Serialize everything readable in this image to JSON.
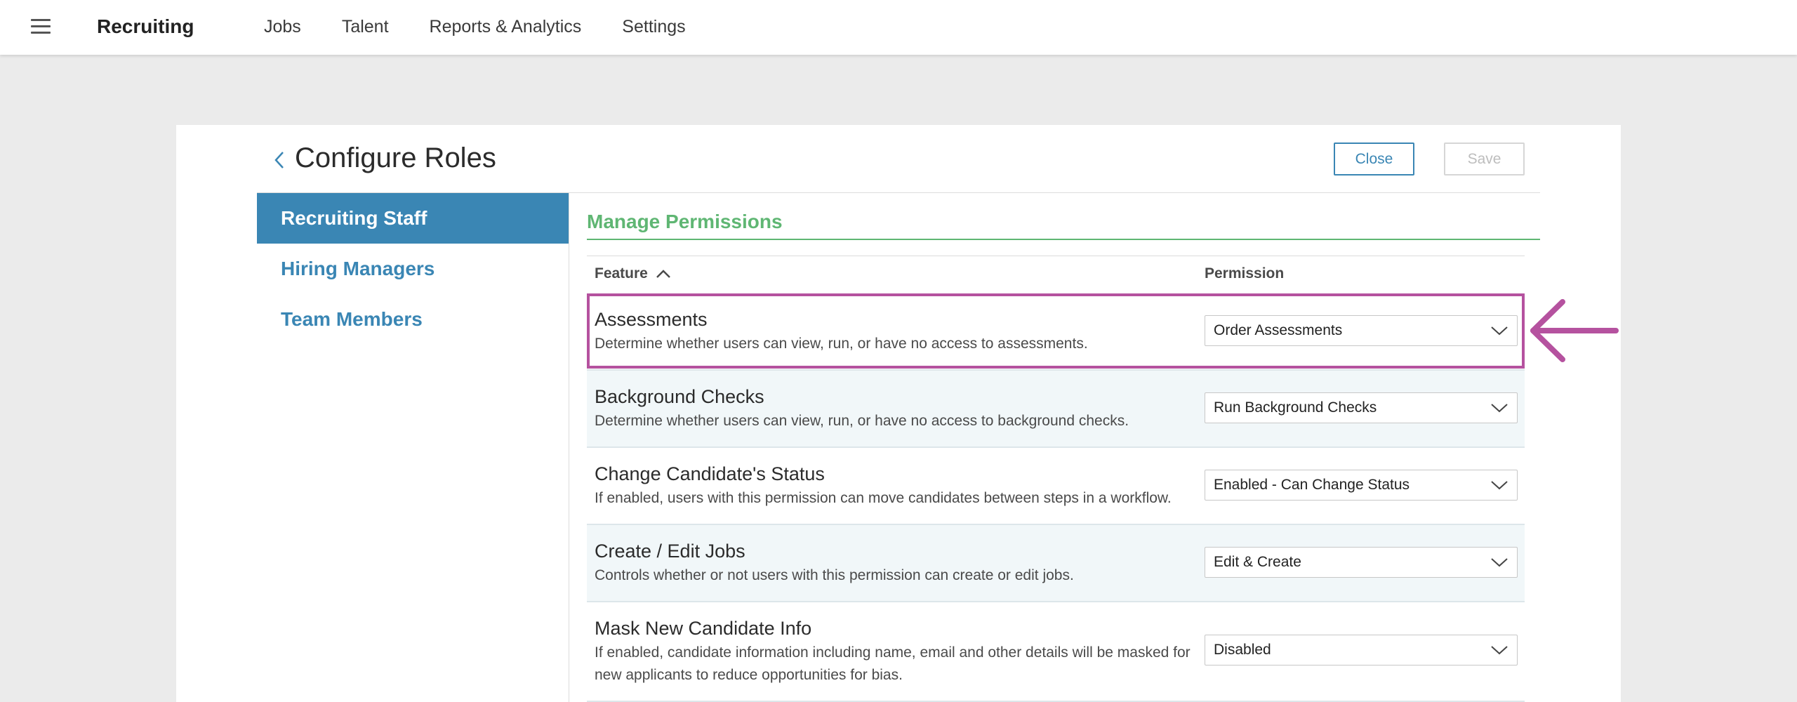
{
  "header": {
    "app_title": "Recruiting",
    "nav": [
      {
        "label": "Jobs"
      },
      {
        "label": "Talent"
      },
      {
        "label": "Reports & Analytics"
      },
      {
        "label": "Settings"
      }
    ]
  },
  "page": {
    "title": "Configure Roles",
    "close_label": "Close",
    "save_label": "Save"
  },
  "sidebar": {
    "items": [
      {
        "label": "Recruiting Staff",
        "active": true
      },
      {
        "label": "Hiring Managers",
        "active": false
      },
      {
        "label": "Team Members",
        "active": false
      }
    ]
  },
  "permissions": {
    "section_title": "Manage Permissions",
    "col_feature": "Feature",
    "col_permission": "Permission",
    "rows": [
      {
        "title": "Assessments",
        "description": "Determine whether users can view, run, or have no access to assessments.",
        "value": "Order Assessments"
      },
      {
        "title": "Background Checks",
        "description": "Determine whether users can view, run, or have no access to background checks.",
        "value": "Run Background Checks"
      },
      {
        "title": "Change Candidate's Status",
        "description": "If enabled, users with this permission can move candidates between steps in a workflow.",
        "value": "Enabled - Can Change Status"
      },
      {
        "title": "Create / Edit Jobs",
        "description": "Controls whether or not users with this permission can create or edit jobs.",
        "value": "Edit & Create"
      },
      {
        "title": "Mask New Candidate Info",
        "description": "If enabled, candidate information including name, email and other details will be masked for new applicants to reduce opportunities for bias.",
        "value": "Disabled"
      }
    ]
  },
  "colors": {
    "primary_blue": "#3a86b4",
    "section_green": "#5fb673",
    "highlight_magenta": "#b5529f"
  },
  "icons": {
    "menu": "hamburger-menu-icon",
    "back": "chevron-left-icon",
    "sort": "chevron-up-icon",
    "dropdown": "chevron-down-icon",
    "annotation": "arrow-left-icon"
  }
}
